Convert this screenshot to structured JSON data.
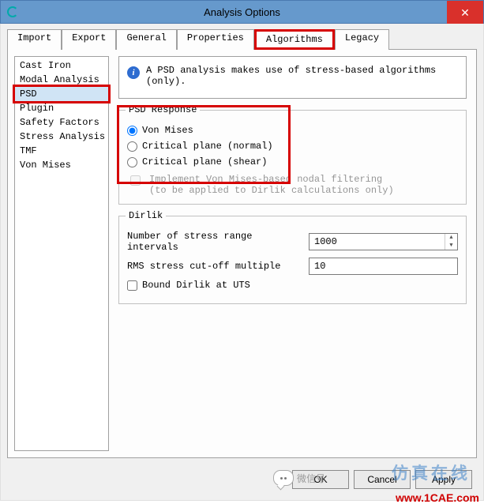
{
  "window": {
    "title": "Analysis Options",
    "close_glyph": "✕"
  },
  "tabs": {
    "t0": "Import",
    "t1": "Export",
    "t2": "General",
    "t3": "Properties",
    "t4": "Algorithms",
    "t5": "Legacy"
  },
  "sidebar": {
    "items": {
      "i0": "Cast Iron",
      "i1": "Modal Analysis",
      "i2": "PSD",
      "i3": "Plugin",
      "i4": "Safety Factors",
      "i5": "Stress Analysis",
      "i6": "TMF",
      "i7": "Von Mises"
    }
  },
  "info": {
    "glyph": "i",
    "text": "A PSD analysis makes use of stress-based algorithms (only)."
  },
  "psd_response": {
    "legend": "PSD Response",
    "opt_vonmises": "Von Mises",
    "opt_normal": "Critical plane (normal)",
    "opt_shear": "Critical plane (shear)",
    "filter_line1": "Implement Von Mises-based nodal filtering",
    "filter_line2": "(to be applied to Dirlik calculations only)"
  },
  "dirlik": {
    "legend": "Dirlik",
    "intervals_label": "Number of stress range intervals",
    "intervals_value": "1000",
    "rms_label": "RMS stress cut-off multiple",
    "rms_value": "10",
    "bound_label": "Bound Dirlik at UTS"
  },
  "buttons": {
    "ok": "OK",
    "cancel": "Cancel",
    "apply": "Apply"
  },
  "watermarks": {
    "wechat_label": "微信号",
    "overlay": "仿真在线",
    "url": "www.1CAE.com"
  }
}
